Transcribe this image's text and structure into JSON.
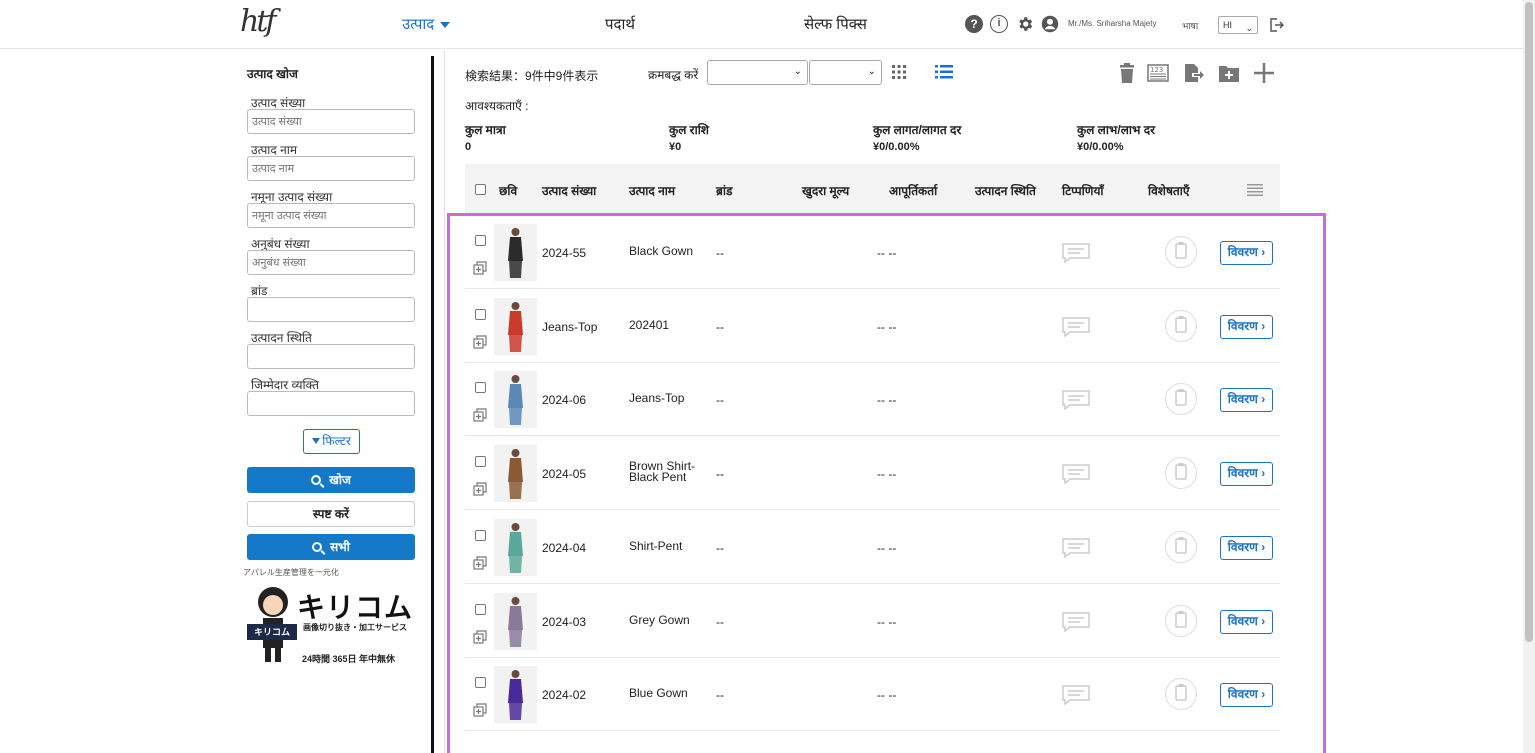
{
  "header": {
    "nav": [
      {
        "label": "उत्पाद",
        "active": true
      },
      {
        "label": "पदार्थ",
        "active": false
      },
      {
        "label": "सेल्फ पिक्स",
        "active": false
      }
    ],
    "user_name": "Mr./Ms. Sriharsha Majety",
    "lang_label": "भाषा",
    "lang_value": "HI"
  },
  "sidebar": {
    "title": "उत्पाद खोज",
    "fields": [
      {
        "label": "उत्पाद संख्या",
        "placeholder": "उत्पाद संख्या"
      },
      {
        "label": "उत्पाद नाम",
        "placeholder": "उत्पाद नाम"
      },
      {
        "label": "नमूना उत्पाद संख्या",
        "placeholder": "नमूना उत्पाद संख्या"
      },
      {
        "label": "अनुबंध संख्या",
        "placeholder": "अनुबंध संख्या"
      },
      {
        "label": "ब्रांड",
        "placeholder": ""
      },
      {
        "label": "उत्पादन स्थिति",
        "placeholder": ""
      },
      {
        "label": "जिम्मेदार व्यक्ति",
        "placeholder": ""
      }
    ],
    "filter_label": "फिल्टर",
    "search_label": "खोज",
    "clear_label": "स्पष्ट करें",
    "all_label": "सभी",
    "ad": {
      "caption": "アパレル生産管理を一元化",
      "title": "キリコム",
      "tag": "キリコム",
      "sub": "画像切り抜き・加工サービス",
      "foot": "24時間 365日 年中無休"
    }
  },
  "toolbar": {
    "result_text": "検索結果：9件中9件表示",
    "sort_label": "क्रमबद्ध करें"
  },
  "summary": {
    "requirements_label": "आवश्यकताएँ :",
    "items": [
      {
        "label": "कुल मात्रा",
        "value": "0"
      },
      {
        "label": "कुल राशि",
        "value": "¥0"
      },
      {
        "label": "कुल लागत/लागत दर",
        "value": "¥0/0.00%"
      },
      {
        "label": "कुल लाभ/लाभ दर",
        "value": "¥0/0.00%"
      }
    ]
  },
  "table": {
    "headers": [
      "छवि",
      "उत्पाद संख्या",
      "उत्पाद नाम",
      "ब्रांड",
      "खुदरा मूल्य",
      "आपूर्तिकर्ता",
      "उत्पादन स्थिति",
      "टिप्पणियाँ",
      "विशेषताएँ"
    ],
    "detail_label": "विवरण",
    "rows": [
      {
        "number": "2024-55",
        "name": "Black Gown",
        "brand": "--",
        "supplier": "-- --",
        "thumb_color": "#2b2b2b"
      },
      {
        "number": "Jeans-Top",
        "name": "202401",
        "brand": "--",
        "supplier": "-- --",
        "thumb_color": "#c83a2a"
      },
      {
        "number": "2024-06",
        "name": "Jeans-Top",
        "brand": "--",
        "supplier": "-- --",
        "thumb_color": "#5b88b8"
      },
      {
        "number": "2024-05",
        "name": "Brown Shirt-Black Pent",
        "brand": "--",
        "supplier": "-- --",
        "thumb_color": "#8a5a34"
      },
      {
        "number": "2024-04",
        "name": "Shirt-Pent",
        "brand": "--",
        "supplier": "-- --",
        "thumb_color": "#5aa89a"
      },
      {
        "number": "2024-03",
        "name": "Grey Gown",
        "brand": "--",
        "supplier": "-- --",
        "thumb_color": "#8a7a9a"
      },
      {
        "number": "2024-02",
        "name": "Blue Gown",
        "brand": "--",
        "supplier": "-- --",
        "thumb_color": "#4a2a9a"
      }
    ]
  },
  "colors": {
    "accent": "#1a73c8",
    "highlight": "#c96ae0"
  }
}
